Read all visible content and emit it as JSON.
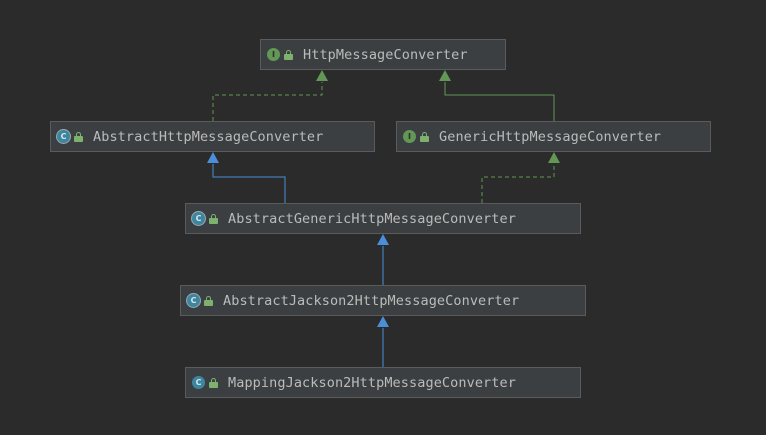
{
  "diagram": {
    "nodes": [
      {
        "id": "http-message-converter",
        "label": "HttpMessageConverter",
        "kind": "interface",
        "icon_letter": "I"
      },
      {
        "id": "abstract-http-message-converter",
        "label": "AbstractHttpMessageConverter",
        "kind": "abstract-class",
        "icon_letter": "C"
      },
      {
        "id": "generic-http-message-converter",
        "label": "GenericHttpMessageConverter",
        "kind": "interface",
        "icon_letter": "I"
      },
      {
        "id": "abstract-generic-http-message-converter",
        "label": "AbstractGenericHttpMessageConverter",
        "kind": "abstract-class",
        "icon_letter": "C"
      },
      {
        "id": "abstract-jackson2-http-message-converter",
        "label": "AbstractJackson2HttpMessageConverter",
        "kind": "abstract-class",
        "icon_letter": "C"
      },
      {
        "id": "mapping-jackson2-http-message-converter",
        "label": "MappingJackson2HttpMessageConverter",
        "kind": "class",
        "icon_letter": "C"
      }
    ],
    "edges": [
      {
        "from": "abstract-http-message-converter",
        "to": "http-message-converter",
        "relation": "implements"
      },
      {
        "from": "generic-http-message-converter",
        "to": "http-message-converter",
        "relation": "extends-interface"
      },
      {
        "from": "abstract-generic-http-message-converter",
        "to": "abstract-http-message-converter",
        "relation": "extends"
      },
      {
        "from": "abstract-generic-http-message-converter",
        "to": "generic-http-message-converter",
        "relation": "implements"
      },
      {
        "from": "abstract-jackson2-http-message-converter",
        "to": "abstract-generic-http-message-converter",
        "relation": "extends"
      },
      {
        "from": "mapping-jackson2-http-message-converter",
        "to": "abstract-jackson2-http-message-converter",
        "relation": "extends"
      }
    ],
    "colors": {
      "background": "#2b2b2b",
      "node_fill": "#3c3f41",
      "node_border": "#5b5b5b",
      "text": "#bbbbbb",
      "extends_edge": "#4a8fd9",
      "implements_edge": "#629755",
      "interface_icon": "#629755",
      "class_icon": "#3e86a0",
      "lock_icon": "#7eb16d"
    }
  }
}
